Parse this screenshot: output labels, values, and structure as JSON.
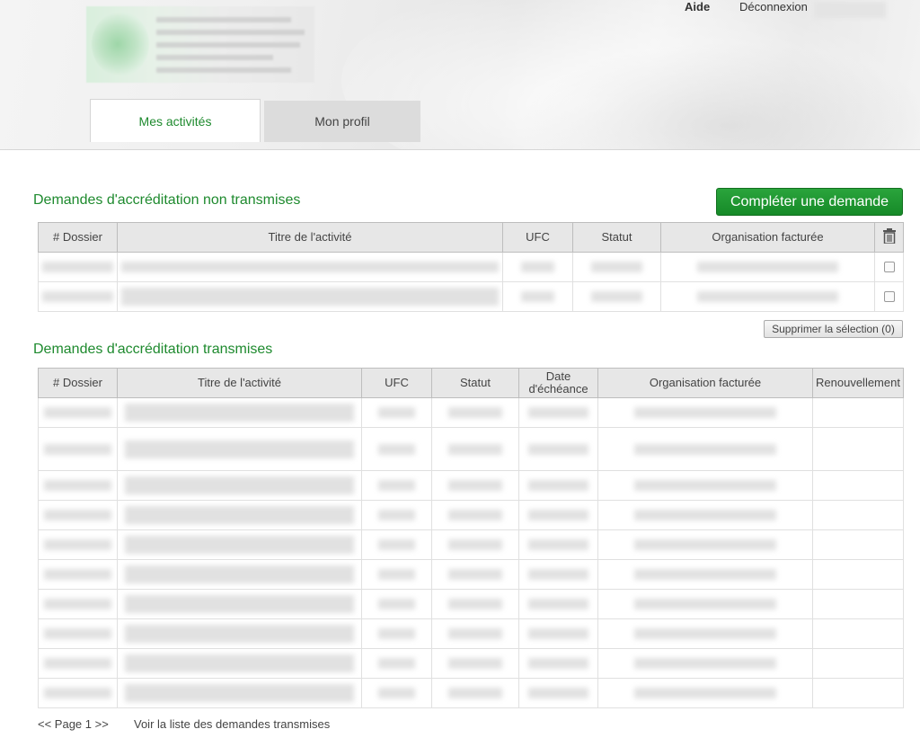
{
  "header": {
    "links": {
      "help": "Aide",
      "logout": "Déconnexion"
    },
    "tabs": [
      {
        "label": "Mes activités",
        "active": true
      },
      {
        "label": "Mon profil",
        "active": false
      }
    ]
  },
  "pending": {
    "title": "Demandes d'accréditation non transmises",
    "complete_button": "Compléter une demande",
    "columns": [
      "# Dossier",
      "Titre de l'activité",
      "UFC",
      "Statut",
      "Organisation facturée"
    ],
    "delete_icon": "trash-icon",
    "row_count": 2,
    "delete_selection_button": "Supprimer la sélection (0)"
  },
  "submitted": {
    "title": "Demandes d'accréditation transmises",
    "columns": [
      "# Dossier",
      "Titre de l'activité",
      "UFC",
      "Statut",
      "Date d'échéance",
      "Organisation facturée",
      "Renouvellement"
    ],
    "row_count": 10
  },
  "footer": {
    "pager": "<< Page 1 >>",
    "view_list": "Voir la liste des demandes transmises"
  },
  "colors": {
    "accent": "#1e8a2e",
    "button_green": "#168a28"
  }
}
